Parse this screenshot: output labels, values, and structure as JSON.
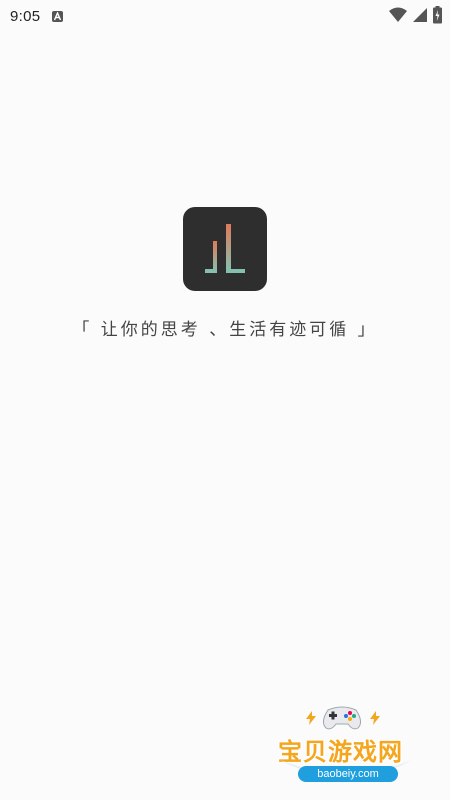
{
  "status_bar": {
    "time": "9:05",
    "icons": [
      "a-notification-icon",
      "wifi-icon",
      "signal-icon",
      "battery-icon"
    ]
  },
  "splash": {
    "tagline": "「 让你的思考 、生活有迹可循 」",
    "logo_icon": "app-logo-icon"
  },
  "watermark": {
    "title": "宝贝游戏网",
    "url": "baobeiy.com"
  },
  "colors": {
    "background": "#fbfbfb",
    "logo_bg": "#2e2e2e",
    "logo_accent_orange": "#e07a5a",
    "logo_accent_teal": "#7fc3b3",
    "watermark_orange": "#f3a61e",
    "watermark_blue": "#1f9fdd"
  }
}
